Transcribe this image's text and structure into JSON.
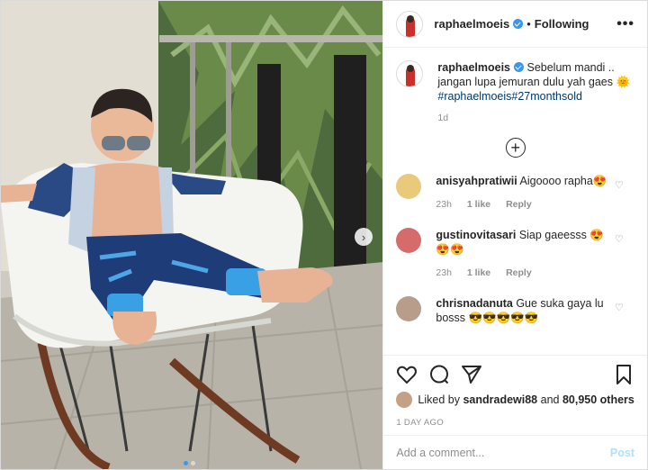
{
  "header": {
    "username": "raphaelmoeis",
    "separator": "•",
    "follow_status": "Following",
    "more_label": "•••"
  },
  "caption": {
    "username": "raphaelmoeis",
    "text_line1": "Sebelum mandi ..",
    "text_line2": "jangan lupa jemuran dulu yah gaes 🌞",
    "hashtags": "#raphaelmoeis#27monthsold",
    "time": "1d"
  },
  "add_comment_icon": "+",
  "comments": [
    {
      "username": "anisyahpratiwii",
      "text": "Aigoooo rapha😍",
      "age": "23h",
      "likes": "1 like",
      "reply": "Reply",
      "avatar_color": "#e9c97a"
    },
    {
      "username": "gustinovitasari",
      "text": "Siap gaeesss 😍😍😍",
      "age": "23h",
      "likes": "1 like",
      "reply": "Reply",
      "avatar_color": "#d66b6b"
    },
    {
      "username": "chrisnadanuta",
      "text": "Gue suka gaya lu bosss 😎😎😎😎😎",
      "avatar_color": "#b89e8a"
    }
  ],
  "actions": {
    "liked_prefix": "Liked by",
    "liked_user": "sandradewi88",
    "liked_and": "and",
    "liked_others": "80,950 others",
    "posted": "1 DAY AGO"
  },
  "comment_box": {
    "placeholder": "Add a comment...",
    "post_label": "Post"
  },
  "carousel": {
    "next_icon": "›",
    "current": 1,
    "total": 2
  },
  "colors": {
    "verified": "#3897f0",
    "link": "#00376b",
    "muted": "#8e8e8e",
    "post_disabled": "#b2dffc"
  }
}
